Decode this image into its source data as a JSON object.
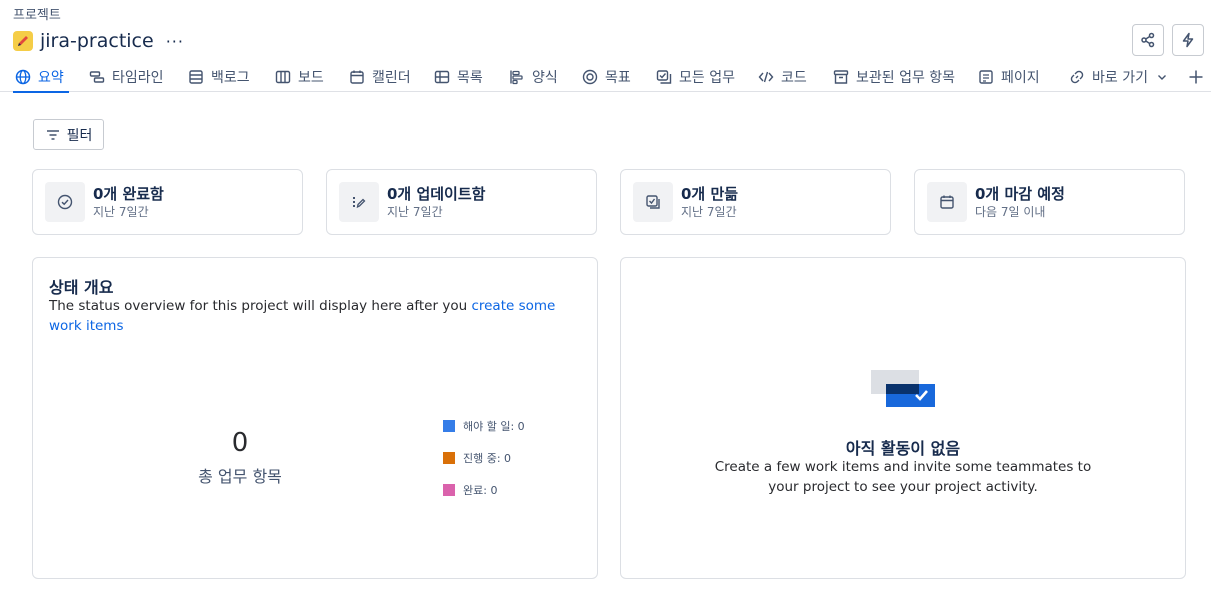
{
  "breadcrumb": "프로젝트",
  "project": {
    "title": "jira-practice",
    "more_label": "···"
  },
  "tabs": [
    {
      "label": "요약",
      "icon": "globe-icon"
    },
    {
      "label": "타임라인",
      "icon": "timeline-icon"
    },
    {
      "label": "백로그",
      "icon": "backlog-icon"
    },
    {
      "label": "보드",
      "icon": "board-icon"
    },
    {
      "label": "캘린더",
      "icon": "calendar-icon"
    },
    {
      "label": "목록",
      "icon": "list-icon"
    },
    {
      "label": "양식",
      "icon": "form-icon"
    },
    {
      "label": "목표",
      "icon": "goal-icon"
    },
    {
      "label": "모든 업무",
      "icon": "all-work-icon"
    },
    {
      "label": "코드",
      "icon": "code-icon"
    },
    {
      "label": "보관된 업무 항목",
      "icon": "archive-icon"
    },
    {
      "label": "페이지",
      "icon": "page-icon"
    },
    {
      "label": "바로 가기",
      "icon": "link-icon"
    }
  ],
  "filter": {
    "label": "필터"
  },
  "stats": [
    {
      "main": "0개 완료함",
      "sub": "지난 7일간",
      "icon": "check-circle-icon"
    },
    {
      "main": "0개 업데이트함",
      "sub": "지난 7일간",
      "icon": "pencil-icon"
    },
    {
      "main": "0개 만듦",
      "sub": "지난 7일간",
      "icon": "created-icon"
    },
    {
      "main": "0개 마감 예정",
      "sub": "다음 7일 이내",
      "icon": "calendar-icon"
    }
  ],
  "status_overview": {
    "title": "상태 개요",
    "desc_before": "The status overview for this project will display here after you ",
    "desc_link": "create some work items",
    "total_count": "0",
    "total_label": "총 업무 항목",
    "legend": [
      {
        "label": "해야 할 일: 0",
        "color": "#357de8"
      },
      {
        "label": "진행 중: 0",
        "color": "#d97008"
      },
      {
        "label": "완료: 0",
        "color": "#da62ac"
      }
    ]
  },
  "activity": {
    "title": "아직 활동이 없음",
    "desc": "Create a few work items and invite some teammates to your project to see your project activity."
  },
  "colors": {
    "accent": "#0c66e4",
    "project_icon": "#f5cd47"
  }
}
